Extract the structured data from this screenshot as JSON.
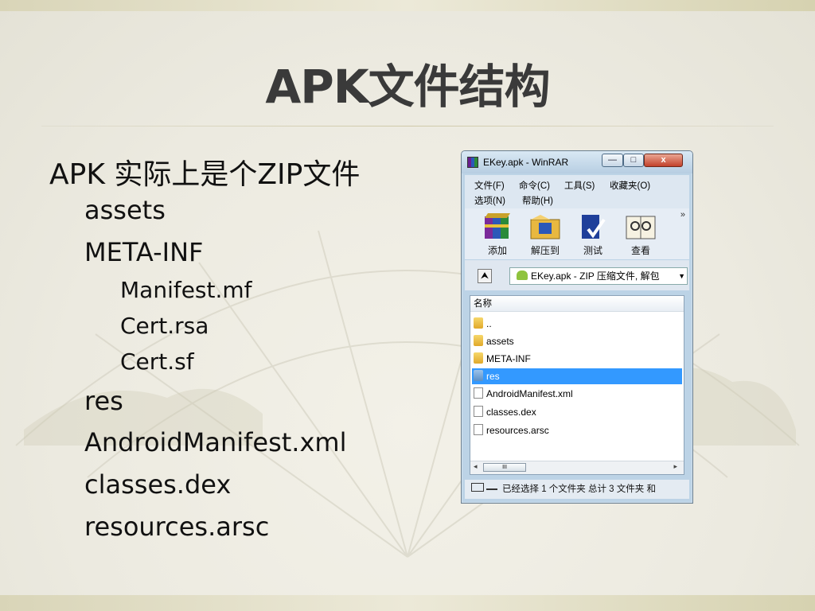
{
  "slide": {
    "title": "APK文件结构",
    "bullets": [
      {
        "level": 1,
        "text": "APK 实际上是个ZIP文件"
      },
      {
        "level": 2,
        "text": "assets"
      },
      {
        "level": 2,
        "text": "META-INF"
      },
      {
        "level": 3,
        "text": "Manifest.mf"
      },
      {
        "level": 3,
        "text": "Cert.rsa"
      },
      {
        "level": 3,
        "text": "Cert.sf"
      },
      {
        "level": 2,
        "text": "res"
      },
      {
        "level": 2,
        "text": "AndroidManifest.xml"
      },
      {
        "level": 2,
        "text": "classes.dex"
      },
      {
        "level": 2,
        "text": "resources.arsc"
      }
    ]
  },
  "window": {
    "title": "EKey.apk - WinRAR",
    "buttons": {
      "minimize": "—",
      "maximize": "□",
      "close": "x"
    },
    "menu": [
      "文件(F)",
      "命令(C)",
      "工具(S)",
      "收藏夹(O)",
      "选项(N)",
      "帮助(H)"
    ],
    "toolbar": [
      "添加",
      "解压到",
      "测试",
      "查看"
    ],
    "toolbar_more": "»",
    "address": "EKey.apk - ZIP 压缩文件, 解包",
    "column_header": "名称",
    "files": [
      {
        "name": "..",
        "type": "folder"
      },
      {
        "name": "assets",
        "type": "folder"
      },
      {
        "name": "META-INF",
        "type": "folder"
      },
      {
        "name": "res",
        "type": "folder",
        "selected": true
      },
      {
        "name": "AndroidManifest.xml",
        "type": "file"
      },
      {
        "name": "classes.dex",
        "type": "file"
      },
      {
        "name": "resources.arsc",
        "type": "file"
      }
    ],
    "scroll_thumb": "III",
    "status": "已经选择 1 个文件夹 总计 3 文件夹 和"
  },
  "icons": [
    "winrar-app-icon",
    "add-icon",
    "extract-icon",
    "test-icon",
    "view-icon",
    "up-folder-icon",
    "android-icon",
    "folder-icon",
    "file-icon",
    "disk-icon",
    "key-icon"
  ]
}
